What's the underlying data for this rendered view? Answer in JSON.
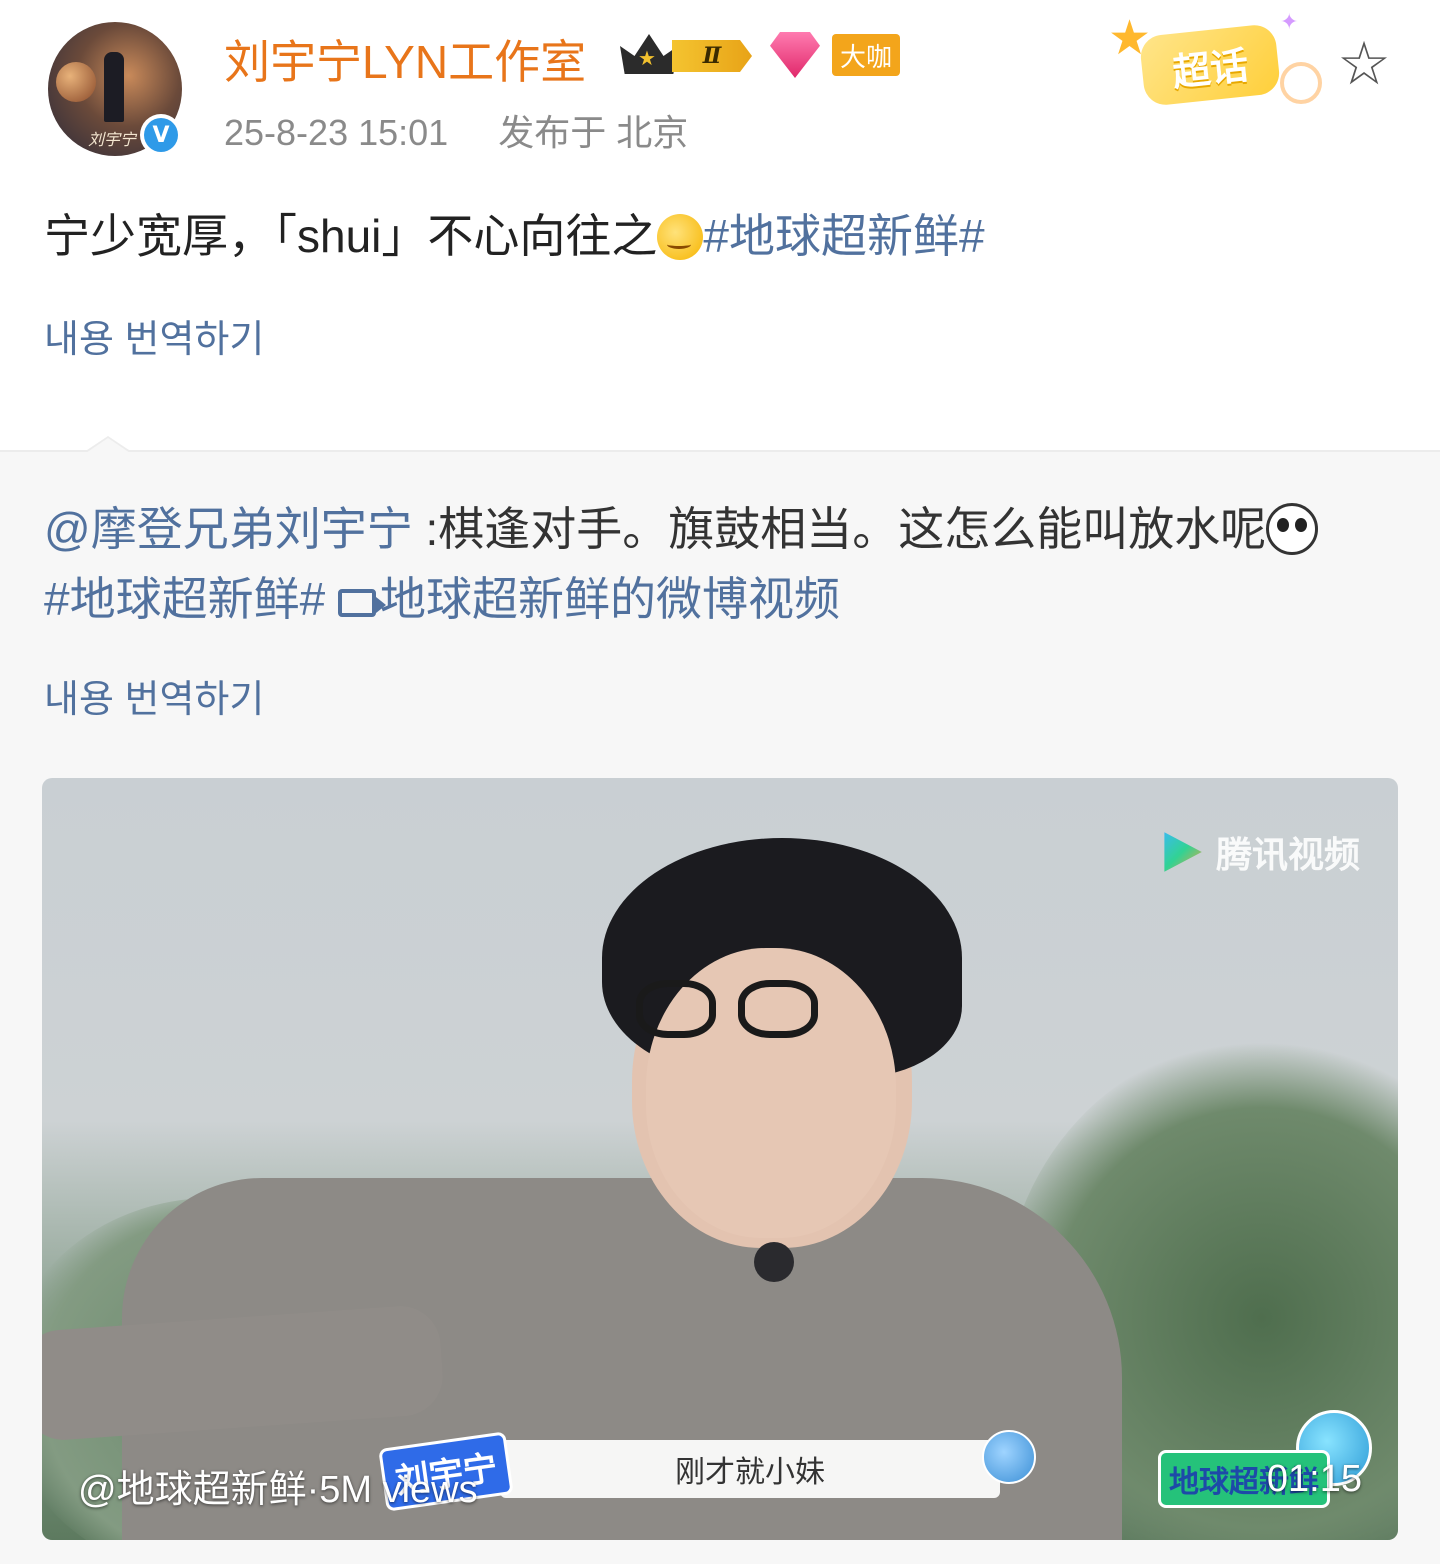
{
  "header": {
    "username": "刘宇宁LYN工作室",
    "level_badge": "Ⅱ",
    "vip_badge": "大咖",
    "timestamp": "25-8-23 15:01",
    "location": "发布于 北京",
    "supertopic_label": "超话",
    "avatar_signature": "刘宇宁",
    "verified_mark": "V"
  },
  "post": {
    "text": "宁少宽厚，「shui」不心向往之",
    "emoji": "blush-emoji",
    "hashtag": "#地球超新鲜#",
    "translate_label": "내용 번역하기"
  },
  "repost": {
    "mention": "@摩登兄弟刘宇宁",
    "text": " :棋逢对手。旗鼓相当。这怎么能叫放水呢",
    "emoji": "panda-emoji",
    "hashtag": "#地球超新鲜#",
    "video_link": "地球超新鲜的微博视频",
    "translate_label": "내용 번역하기"
  },
  "video": {
    "watermark": "腾讯视频",
    "name_tag": "刘宇宁",
    "subtitle": "刚才就小妹",
    "show_logo": "地球超新鲜",
    "caption": "@地球超新鲜·5M views",
    "duration": "01:15"
  },
  "colors": {
    "username": "#e8751a",
    "link": "#51719e",
    "meta": "#8a8a8a",
    "repost_bg": "#f7f7f7"
  }
}
